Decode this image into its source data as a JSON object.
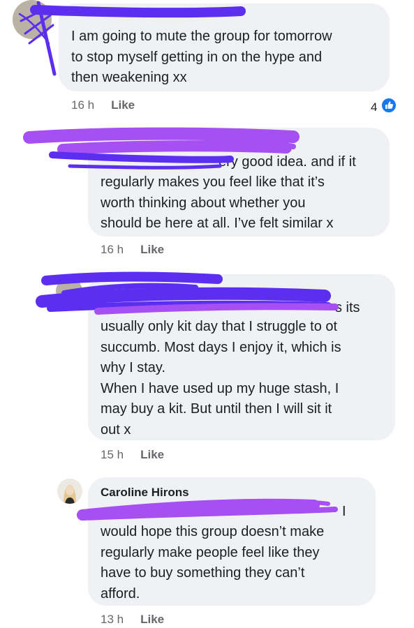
{
  "comments": [
    {
      "text": "I am going to mute the group for tomorrow\nto stop myself getting in on the hype and\nthen weakening xx",
      "time": "16 h",
      "like_label": "Like",
      "reaction_count": "4"
    },
    {
      "text_line1": "ery good idea. and if it",
      "text_rest": "regularly makes you feel like that it’s\nworth thinking about whether you\nshould be here at all. I’ve felt similar x",
      "time": "16 h",
      "like_label": "Like"
    },
    {
      "text_line1": "s its",
      "text_rest": "usually only kit day that I struggle to  ot\nsuccumb. Most days I enjoy it, which is\nwhy I stay.\nWhen I have used up my huge stash, I\nmay buy a kit. But until then I will sit it\nout x",
      "time": "15 h",
      "like_label": "Like"
    },
    {
      "author": "Caroline Hirons",
      "text_line1": "I",
      "text_rest": "would hope this group doesn’t make\nregularly make people feel like they\nhave to buy something they can’t\nafford.",
      "time": "13 h",
      "like_label": "Like"
    }
  ],
  "colors": {
    "bubble": "#eff1f4",
    "meta_text": "#65676b",
    "like_blue": "#1877f2",
    "redaction_blue": "#5b2ef0",
    "redaction_purple": "#a64ff2"
  }
}
